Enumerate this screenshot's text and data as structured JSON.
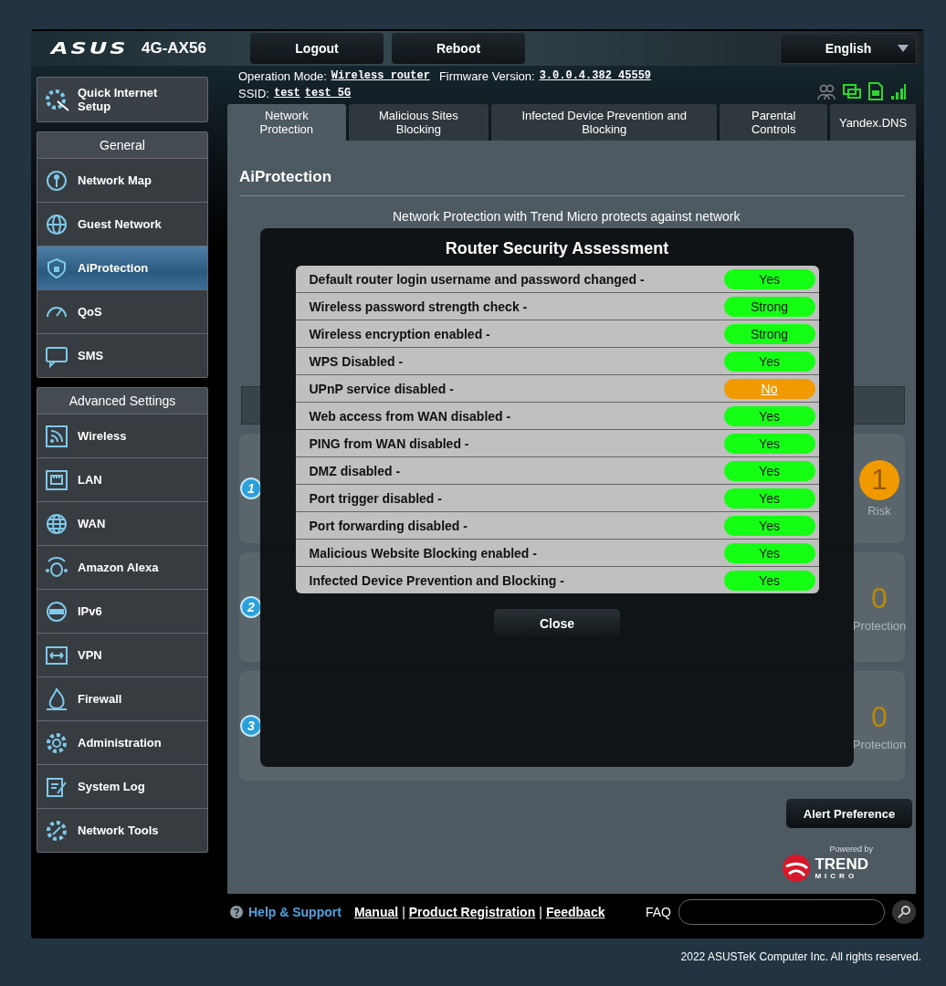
{
  "header": {
    "logo": "ASUS",
    "model": "4G-AX56",
    "buttons": [
      "Logout",
      "Reboot"
    ],
    "language": "English"
  },
  "info": {
    "operation_mode_label": "Operation Mode:",
    "operation_mode": "Wireless router",
    "firmware_label": "Firmware Version:",
    "firmware": "3.0.0.4.382_45559",
    "ssid_label": "SSID:",
    "ssids": [
      "test",
      "test_5G"
    ]
  },
  "sidebar": {
    "quick_setup": "Quick Internet Setup",
    "sections": [
      {
        "title": "General",
        "items": [
          {
            "label": "Network Map",
            "selected": false
          },
          {
            "label": "Guest Network",
            "selected": false
          },
          {
            "label": "AiProtection",
            "selected": true
          },
          {
            "label": "QoS",
            "selected": false
          },
          {
            "label": "SMS",
            "selected": false
          }
        ]
      },
      {
        "title": "Advanced Settings",
        "items": [
          {
            "label": "Wireless",
            "selected": false
          },
          {
            "label": "LAN",
            "selected": false
          },
          {
            "label": "WAN",
            "selected": false
          },
          {
            "label": "Amazon Alexa",
            "selected": false
          },
          {
            "label": "IPv6",
            "selected": false
          },
          {
            "label": "VPN",
            "selected": false
          },
          {
            "label": "Firewall",
            "selected": false
          },
          {
            "label": "Administration",
            "selected": false
          },
          {
            "label": "System Log",
            "selected": false
          },
          {
            "label": "Network Tools",
            "selected": false
          }
        ]
      }
    ]
  },
  "tabs": [
    {
      "label": "Network Protection",
      "selected": true
    },
    {
      "label": "Malicious Sites Blocking",
      "selected": false
    },
    {
      "label": "Infected Device Prevention and Blocking",
      "selected": false
    },
    {
      "label": "Parental Controls",
      "selected": false
    },
    {
      "label": "Yandex.DNS",
      "selected": false
    }
  ],
  "content": {
    "title": "AiProtection",
    "intro": "Network Protection with Trend Micro protects against network",
    "cards": [
      {
        "number": "1",
        "count": "1",
        "kind": "risk",
        "label": "Risk"
      },
      {
        "number": "2",
        "count": "0",
        "kind": "protection",
        "label": "Protection"
      },
      {
        "number": "3",
        "count": "0",
        "kind": "protection",
        "label": "Protection"
      }
    ],
    "alert_button": "Alert Preference",
    "powered_by": "Powered by",
    "vendor": "TREND",
    "vendor_sub": "MICRO"
  },
  "modal": {
    "title": "Router Security Assessment",
    "rows": [
      {
        "label": "Default router login username and password changed -",
        "value": "Yes",
        "kind": "ok"
      },
      {
        "label": "Wireless password strength check -",
        "value": "Strong",
        "kind": "ok"
      },
      {
        "label": "Wireless encryption enabled -",
        "value": "Strong",
        "kind": "ok"
      },
      {
        "label": "WPS Disabled -",
        "value": "Yes",
        "kind": "ok"
      },
      {
        "label": "UPnP service disabled -",
        "value": "No",
        "kind": "risk"
      },
      {
        "label": "Web access from WAN disabled -",
        "value": "Yes",
        "kind": "ok"
      },
      {
        "label": "PING from WAN disabled -",
        "value": "Yes",
        "kind": "ok"
      },
      {
        "label": "DMZ disabled -",
        "value": "Yes",
        "kind": "ok"
      },
      {
        "label": "Port trigger disabled -",
        "value": "Yes",
        "kind": "ok"
      },
      {
        "label": "Port forwarding disabled -",
        "value": "Yes",
        "kind": "ok"
      },
      {
        "label": "Malicious Website Blocking enabled -",
        "value": "Yes",
        "kind": "ok"
      },
      {
        "label": "Infected Device Prevention and Blocking -",
        "value": "Yes",
        "kind": "ok"
      }
    ],
    "close": "Close"
  },
  "footer": {
    "help": "Help & Support",
    "separator": "|",
    "links": [
      "Manual",
      "Product Registration",
      "Feedback"
    ],
    "faq": "FAQ",
    "copyright": "2022 ASUSTeK Computer Inc. All rights reserved."
  }
}
